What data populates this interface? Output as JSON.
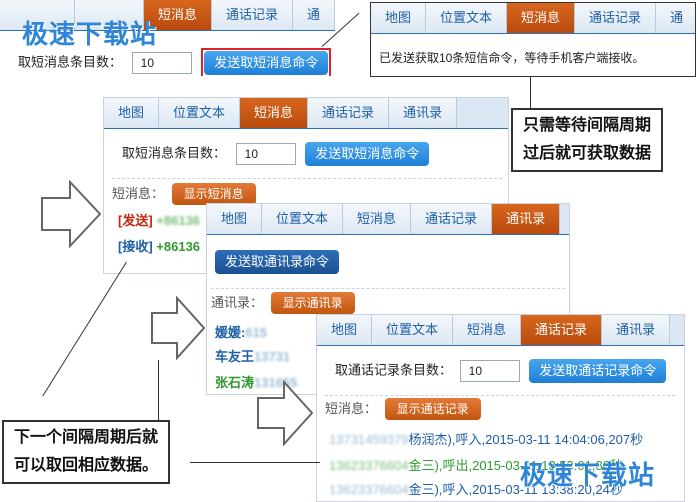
{
  "tabs": {
    "map": "地图",
    "location": "位置文本",
    "sms": "短消息",
    "calls": "通话记录",
    "contacts": "通讯录",
    "contacts_cut": "通讯录",
    "contacts_short": "通"
  },
  "sms_panel": {
    "count_label": "取短消息条目数：",
    "count_value": "10",
    "fetch_button": "发送取短消息命令",
    "list_label": "短消息：",
    "show_button": "显示短消息",
    "send_tag": "[发送]",
    "send_num": "+86136",
    "recv_tag": "[接收]",
    "recv_num": "+86136"
  },
  "status_panel": {
    "message": "已发送获取10条短信命令，等待手机客户端接收。"
  },
  "contacts_panel": {
    "fetch_button": "发送取通讯录命令",
    "list_label": "通讯录：",
    "show_button": "显示通讯录",
    "entries": [
      "媛媛:",
      "车友王",
      "张石涛"
    ]
  },
  "calls_panel": {
    "count_label": "取通话记录条目数：",
    "count_value": "10",
    "fetch_button": "发送取通话记录命令",
    "list_label": "短消息：",
    "show_button": "显示通话记录",
    "records": [
      "杨润杰),呼入,2015-03-11 14:04:06,207秒",
      "金三),呼出,2015-03-11 13:53:01,86秒",
      "金三),呼入,2015-03-11 13:38:20,24秒"
    ]
  },
  "callouts": {
    "top_line1": "只需等待间隔周期",
    "top_line2": "过后就可获取数据",
    "bottom_line1": "下一个间隔周期后就",
    "bottom_line2": "可以取回相应数据。"
  },
  "watermark": "极速下载站"
}
